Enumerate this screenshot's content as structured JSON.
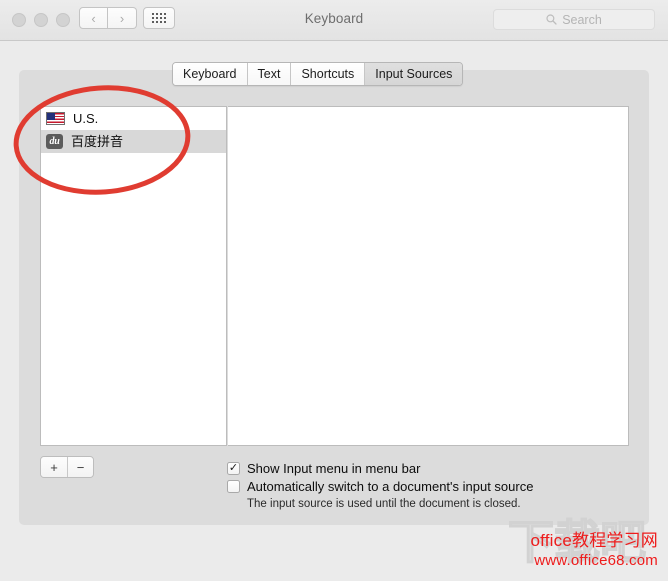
{
  "window": {
    "title": "Keyboard",
    "traffic_lights": [
      "close",
      "minimize",
      "zoom"
    ],
    "nav": {
      "back": "‹",
      "forward": "›",
      "grid": "grid-view"
    }
  },
  "search": {
    "placeholder": "Search",
    "value": "",
    "icon": "search-icon"
  },
  "tabs": [
    {
      "label": "Keyboard",
      "selected": false
    },
    {
      "label": "Text",
      "selected": false
    },
    {
      "label": "Shortcuts",
      "selected": false
    },
    {
      "label": "Input Sources",
      "selected": true
    }
  ],
  "input_sources": [
    {
      "label": "U.S.",
      "icon": "us-flag-icon",
      "selected": false
    },
    {
      "label": "百度拼音",
      "icon": "baidu-du-icon",
      "icon_text": "du",
      "selected": true
    }
  ],
  "list_buttons": {
    "add": "+",
    "remove": "−"
  },
  "options": [
    {
      "label": "Show Input menu in menu bar",
      "checked": true,
      "check_glyph": "✓"
    },
    {
      "label": "Automatically switch to a document's input source",
      "checked": false,
      "check_glyph": ""
    }
  ],
  "helper_text": "The input source is used until the document is closed.",
  "annotation": {
    "shape": "ellipse",
    "color": "#e03c31",
    "target": "input-sources-list"
  },
  "watermark": {
    "line1": "office教程学习网",
    "line2": "www.office68.com",
    "background_text": "下载吧",
    "color": "#ee1c1c"
  }
}
